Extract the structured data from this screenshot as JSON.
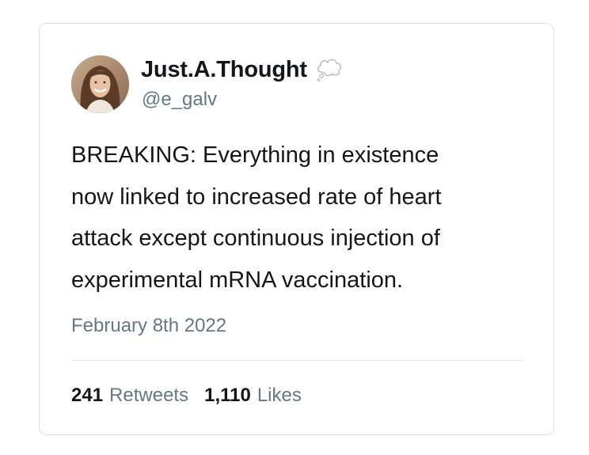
{
  "tweet": {
    "author": {
      "display_name": "Just.A.Thought",
      "handle": "@e_galv",
      "name_icon": "thought-balloon-icon",
      "avatar": "profile-photo"
    },
    "text_lines": [
      "BREAKING: Everything in existence",
      "now linked to increased rate of heart",
      "attack except continuous injection of",
      "experimental mRNA vaccination."
    ],
    "date": "February 8th 2022",
    "stats": {
      "retweets_count": "241",
      "retweets_label": "Retweets",
      "likes_count": "1,110",
      "likes_label": "Likes"
    }
  },
  "colors": {
    "text_primary": "#14171a",
    "text_secondary": "#657786",
    "border": "#d9e1e8",
    "divider": "#e1e8ed"
  }
}
